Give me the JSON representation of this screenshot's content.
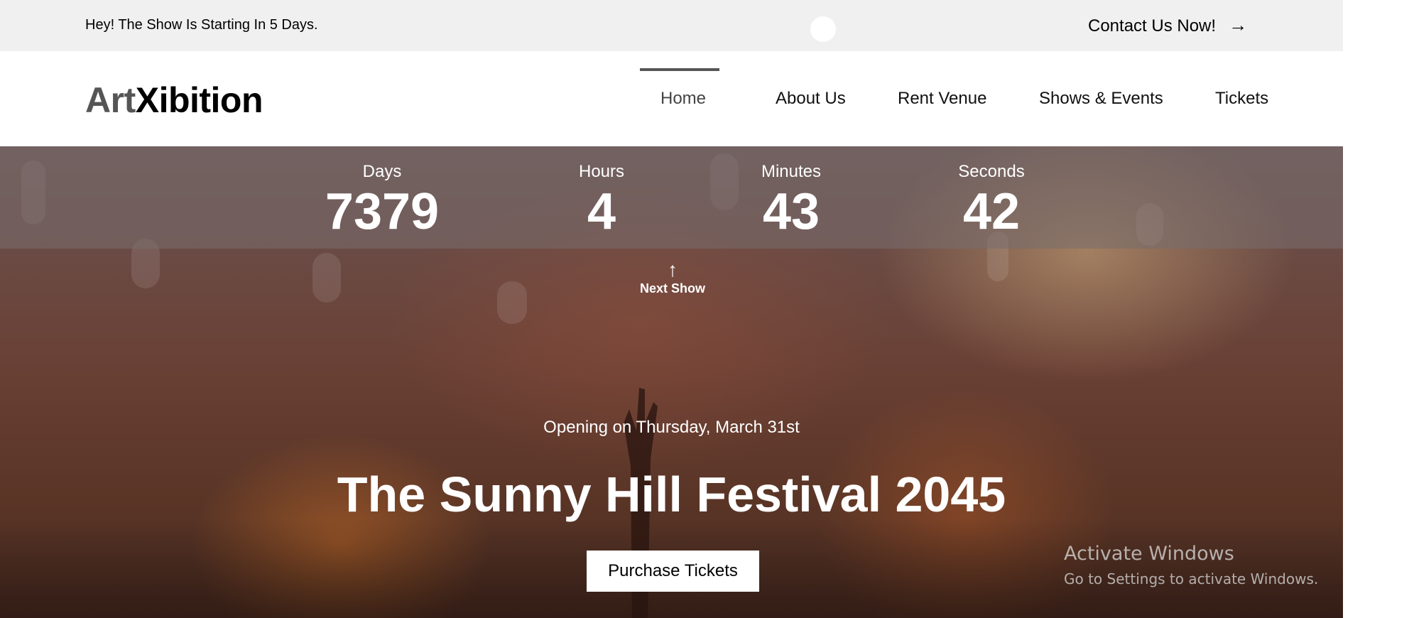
{
  "topbar": {
    "announcement": "Hey! The Show Is Starting In 5 Days.",
    "contact_label": "Contact Us Now!",
    "contact_arrow": "→"
  },
  "header": {
    "logo_part1": "Art",
    "logo_part2": "Xibition",
    "nav": [
      {
        "label": "Home",
        "active": true
      },
      {
        "label": "About Us",
        "active": false
      },
      {
        "label": "Rent Venue",
        "active": false
      },
      {
        "label": "Shows & Events",
        "active": false
      },
      {
        "label": "Tickets",
        "active": false
      }
    ]
  },
  "countdown": {
    "days": {
      "label": "Days",
      "value": "7379"
    },
    "hours": {
      "label": "Hours",
      "value": "4"
    },
    "minutes": {
      "label": "Minutes",
      "value": "43"
    },
    "seconds": {
      "label": "Seconds",
      "value": "42"
    }
  },
  "next_show": {
    "icon": "↑",
    "label": "Next Show"
  },
  "hero": {
    "opening": "Opening on Thursday, March 31st",
    "title": "The Sunny Hill Festival 2045",
    "button_label": "Purchase Tickets"
  },
  "watermark": {
    "line1": "Activate Windows",
    "line2": "Go to Settings to activate Windows."
  },
  "colors": {
    "topbar_bg": "#f0f0f0",
    "logo_art": "#555555",
    "logo_xib": "#000000",
    "nav_indicator": "#555555"
  }
}
